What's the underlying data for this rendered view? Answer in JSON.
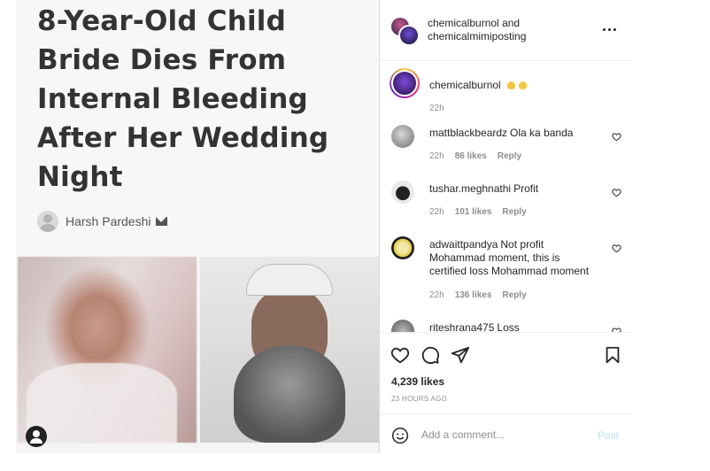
{
  "article": {
    "headline": "8-Year-Old Child Bride Dies From Internal Bleeding After Her Wedding Night",
    "author": "Harsh Pardeshi"
  },
  "post_header": {
    "user1": "chemicalburnol",
    "connector": "and",
    "user2": "chemicalmimiposting"
  },
  "caption": {
    "user": "chemicalburnol",
    "time": "22h"
  },
  "comments": [
    {
      "user": "mattblackbeardz",
      "text": "Ola ka banda",
      "time": "22h",
      "likes": "86 likes",
      "reply": "Reply"
    },
    {
      "user": "tushar.meghnathi",
      "text": "Profit",
      "time": "22h",
      "likes": "101 likes",
      "reply": "Reply"
    },
    {
      "user": "adwaittpandya",
      "text": "Not profit Mohammad moment, this is certified loss Mohammad moment",
      "time": "22h",
      "likes": "136 likes",
      "reply": "Reply"
    },
    {
      "user": "riteshrana475",
      "text": "Loss"
    }
  ],
  "actions": {
    "likes": "4,239 likes",
    "timestamp": "23 HOURS AGO"
  },
  "add_comment": {
    "placeholder": "Add a comment...",
    "post_label": "Post"
  },
  "colors": {
    "accent_disabled": "#b2dffc",
    "muted": "#8e8e8e",
    "text": "#262626"
  }
}
